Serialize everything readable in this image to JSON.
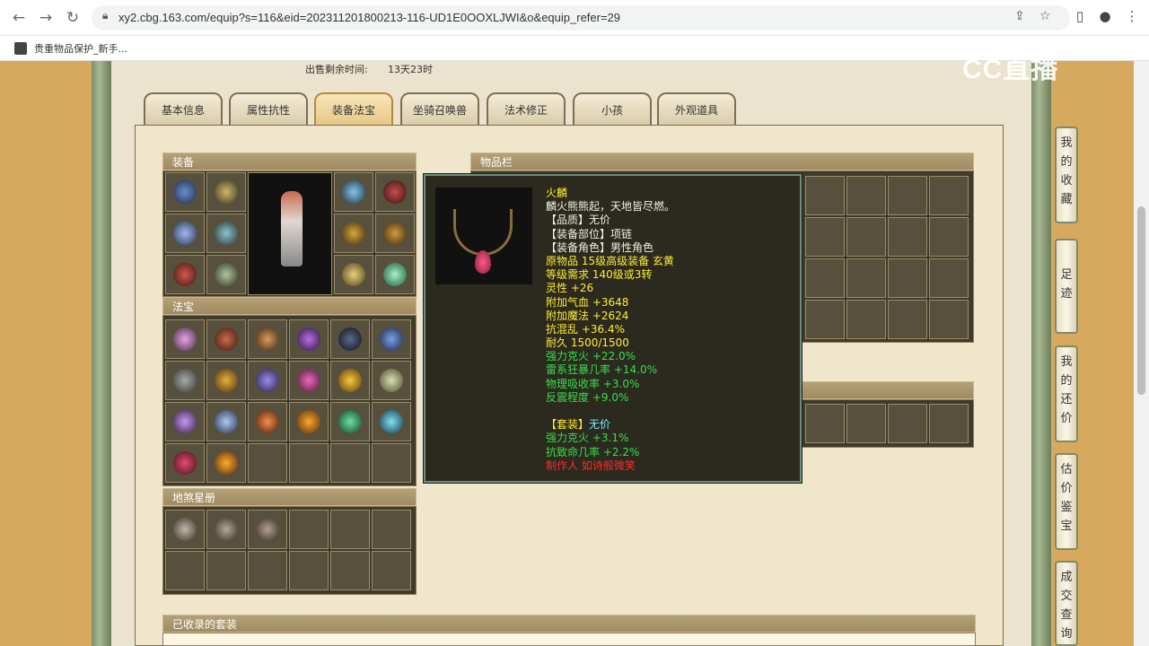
{
  "browser": {
    "url": "xy2.cbg.163.com/equip?s=116&eid=202311201800213-116-UD1E0OOXLJWI&o&equip_refer=29",
    "bookmark_label": "贵重物品保护_新手..."
  },
  "watermark": "CC直播",
  "sale": {
    "label": "出售剩余时间:",
    "value": "13天23时"
  },
  "tabs": [
    "基本信息",
    "属性抗性",
    "装备法宝",
    "坐骑召唤兽",
    "法术修正",
    "小孩",
    "外观道具"
  ],
  "active_tab": "装备法宝",
  "sections": {
    "equipment": "装备",
    "fabao": "法宝",
    "disha": "地煞星册",
    "inventory": "物品栏",
    "suits": "已收录的套装"
  },
  "tooltip": {
    "name": "火麟",
    "desc": "麟火熊熊起，天地皆尽燃。",
    "quality": "【品质】无价",
    "slot": "【装备部位】项链",
    "role": "【装备角色】男性角色",
    "origin": "原物品 15级高级装备 玄黄",
    "level_req": "等级需求 140级或3转",
    "stats": [
      "灵性 +26",
      "附加气血 +3648",
      "附加魔法 +2624",
      "抗混乱 +36.4%",
      "耐久 1500/1500"
    ],
    "bonus": [
      "强力克火 +22.0%",
      "雷系狂暴几率 +14.0%",
      "物理吸收率 +3.0%",
      "反震程度 +9.0%"
    ],
    "set_label": "【套装】",
    "set_value": "无价",
    "set_bonus": [
      "强力克火 +3.1%",
      "抗致命几率 +2.2%"
    ],
    "maker": "制作人 如诗般微笑"
  },
  "side_buttons": [
    "我的收藏",
    "足迹",
    "我的还价",
    "估价鉴宝",
    "成交查询"
  ],
  "colors": {
    "tooltip_name": "#ffee33",
    "tooltip_bonus": "#34e04a",
    "tooltip_maker": "#ff2a2a",
    "panel_bg": "#efe6cc"
  }
}
